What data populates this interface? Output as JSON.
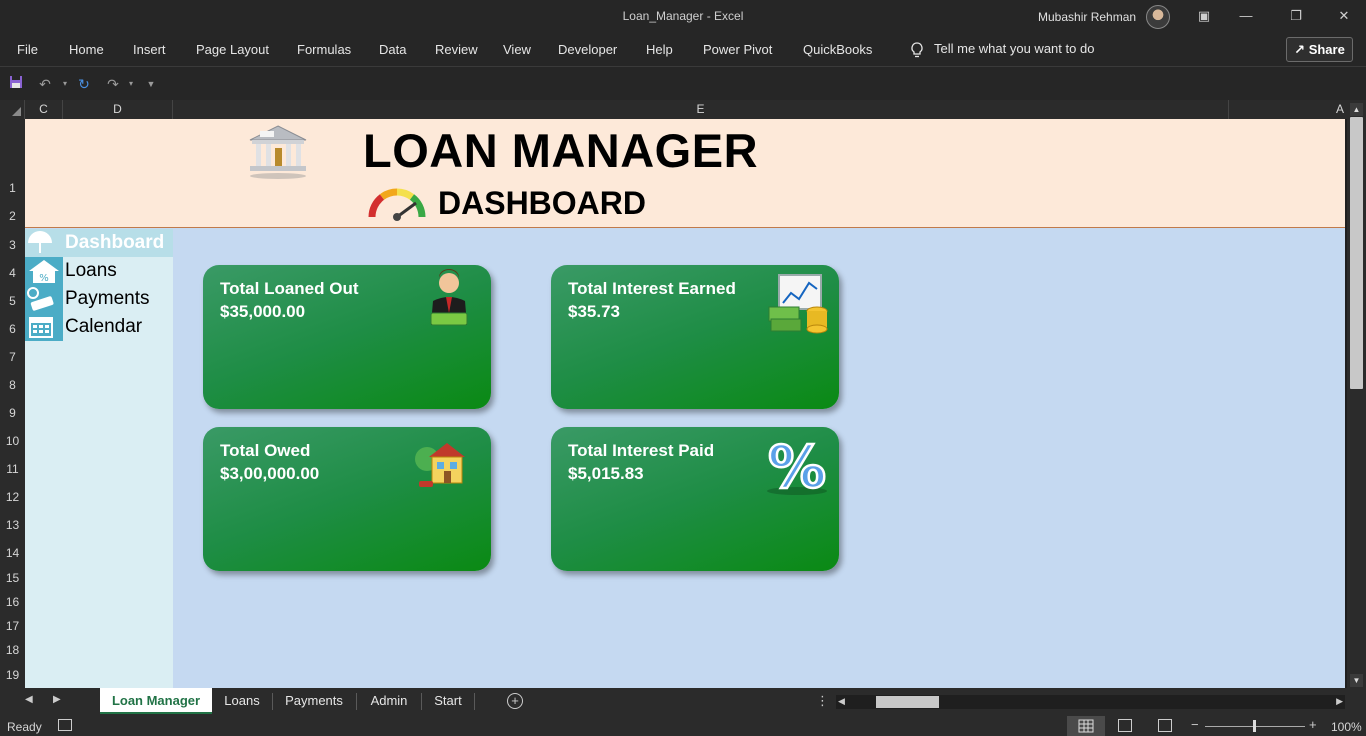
{
  "window": {
    "title": "Loan_Manager  -  Excel",
    "user": "Mubashir Rehman",
    "share_label": "Share"
  },
  "menu": {
    "items": [
      "File",
      "Home",
      "Insert",
      "Page Layout",
      "Formulas",
      "Data",
      "Review",
      "View",
      "Developer",
      "Help",
      "Power Pivot",
      "QuickBooks"
    ],
    "tell_me": "Tell me what you want to do"
  },
  "columns": [
    "C",
    "D",
    "E",
    "A"
  ],
  "rows": [
    "1",
    "2",
    "3",
    "4",
    "5",
    "6",
    "7",
    "8",
    "9",
    "10",
    "11",
    "12",
    "13",
    "14",
    "15",
    "16",
    "17",
    "18",
    "19"
  ],
  "header": {
    "title": "LOAN MANAGER",
    "subtitle": "DASHBOARD"
  },
  "nav": {
    "items": [
      {
        "label": "Dashboard",
        "icon": "umbrella-icon",
        "active": true
      },
      {
        "label": "Loans",
        "icon": "house-percent-icon",
        "active": false
      },
      {
        "label": "Payments",
        "icon": "money-hand-icon",
        "active": false
      },
      {
        "label": "Calendar",
        "icon": "calendar-icon",
        "active": false
      }
    ]
  },
  "cards": [
    {
      "label": "Total Loaned Out",
      "value": "$35,000.00",
      "icon": "businessman-money-icon"
    },
    {
      "label": "Total Interest Earned",
      "value": "$35.73",
      "icon": "chart-money-icon"
    },
    {
      "label": "Total Owed",
      "value": "$3,00,000.00",
      "icon": "house-icon"
    },
    {
      "label": "Total Interest Paid",
      "value": "$5,015.83",
      "icon": "percent-icon"
    }
  ],
  "sheet_tabs": [
    "Loan Manager",
    "Loans",
    "Payments",
    "Admin",
    "Start"
  ],
  "active_tab": "Loan Manager",
  "status": {
    "ready": "Ready",
    "zoom": "100%"
  },
  "colors": {
    "card_green": "#1e8d45",
    "banner_bg": "#fde9d9",
    "sheet_bg": "#c5d9f1",
    "nav_bg": "#daeef3",
    "nav_icon_bg": "#4bacc6",
    "excel_green": "#217346"
  }
}
